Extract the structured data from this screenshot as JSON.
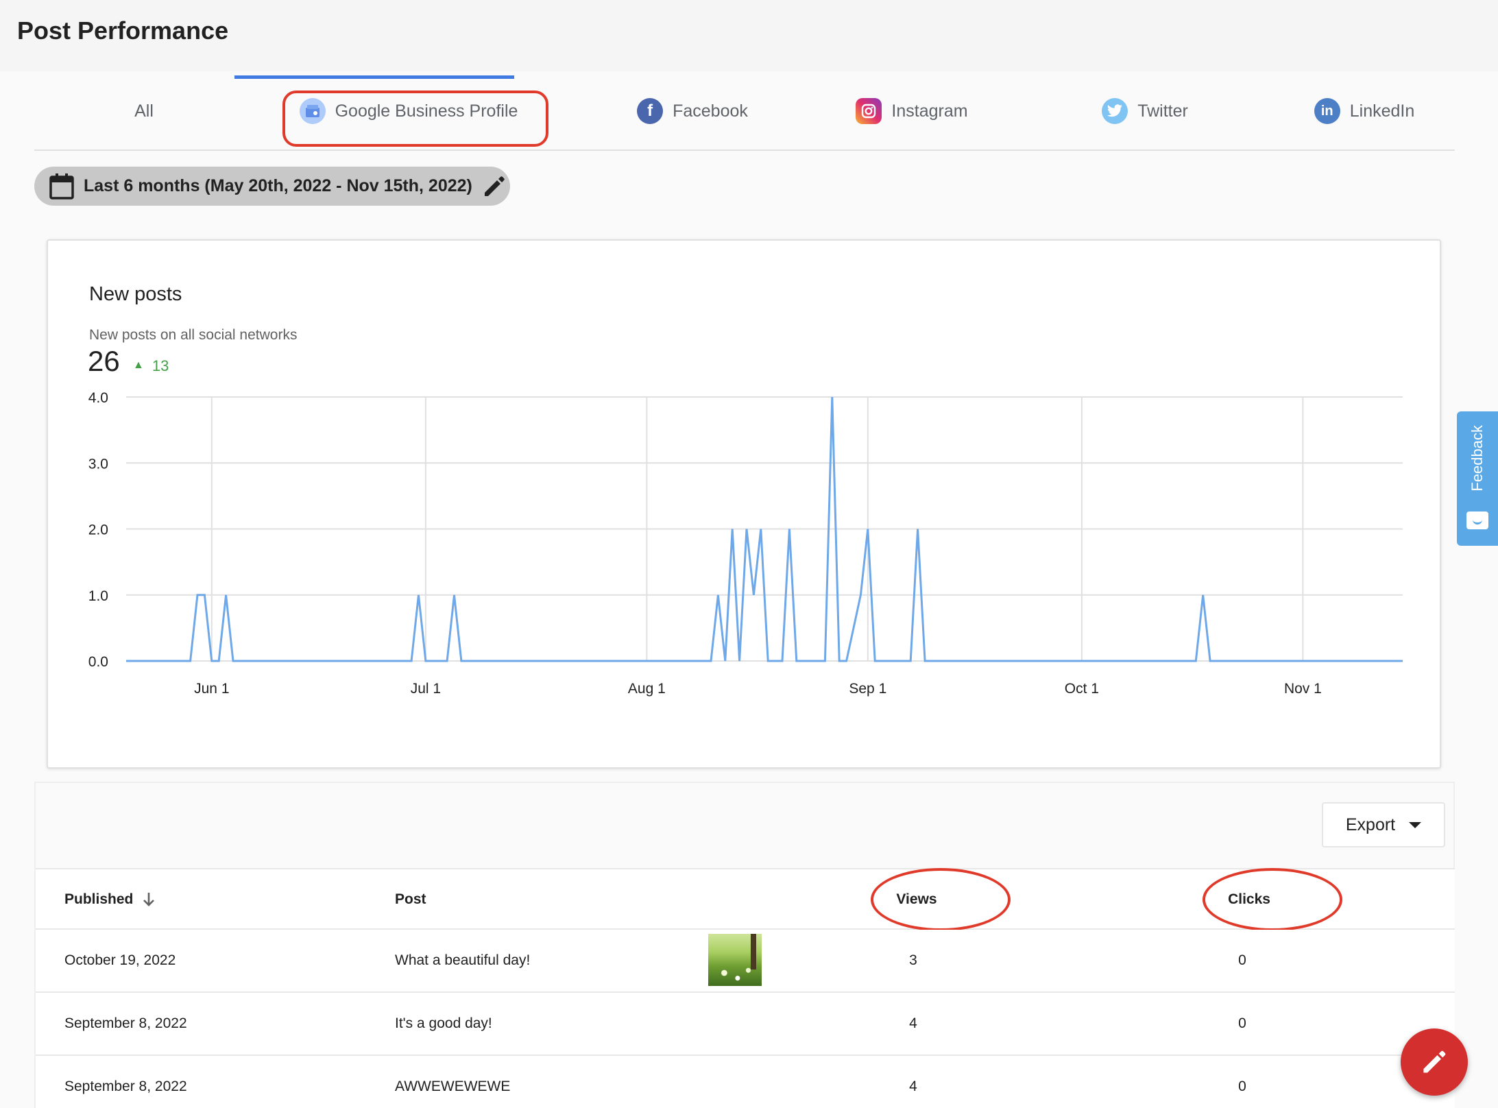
{
  "header": {
    "title": "Post Performance"
  },
  "tabs": [
    {
      "label": "All",
      "icon": ""
    },
    {
      "label": "Google Business Profile",
      "icon": "google-business-icon",
      "color": "#8ab4f8"
    },
    {
      "label": "Facebook",
      "icon": "facebook-icon",
      "color": "#4a67ad"
    },
    {
      "label": "Instagram",
      "icon": "instagram-icon",
      "color": "#d6249f"
    },
    {
      "label": "Twitter",
      "icon": "twitter-icon",
      "color": "#1da1f2"
    },
    {
      "label": "LinkedIn",
      "icon": "linkedin-icon",
      "color": "#0a66c2"
    }
  ],
  "active_tab": "Google Business Profile",
  "date_range": {
    "label": "Last 6 months (May 20th, 2022 - Nov 15th, 2022)"
  },
  "chart_card": {
    "title": "New posts",
    "subtitle": "New posts on all social networks",
    "total": "26",
    "delta": "13"
  },
  "chart_data": {
    "type": "line",
    "title": "New posts",
    "xlabel": "",
    "ylabel": "",
    "color": "#6fa8e8",
    "x_start": "2022-05-20",
    "x_end": "2022-11-15",
    "xlim": [
      "2022-05-20",
      "2022-11-15"
    ],
    "ylim": [
      0,
      4
    ],
    "y_ticks": [
      "0.0",
      "1.0",
      "2.0",
      "3.0",
      "4.0"
    ],
    "x_ticks": [
      {
        "label": "Jun 1",
        "date": "2022-06-01"
      },
      {
        "label": "Jul 1",
        "date": "2022-07-01"
      },
      {
        "label": "Aug 1",
        "date": "2022-08-01"
      },
      {
        "label": "Sep 1",
        "date": "2022-09-01"
      },
      {
        "label": "Oct 1",
        "date": "2022-10-01"
      },
      {
        "label": "Nov 1",
        "date": "2022-11-01"
      }
    ],
    "grid": true,
    "series": [
      {
        "values": [
          [
            "2022-05-20",
            0
          ],
          [
            "2022-05-29",
            0
          ],
          [
            "2022-05-30",
            1
          ],
          [
            "2022-05-31",
            1
          ],
          [
            "2022-06-01",
            0
          ],
          [
            "2022-06-02",
            0
          ],
          [
            "2022-06-03",
            1
          ],
          [
            "2022-06-04",
            0
          ],
          [
            "2022-06-29",
            0
          ],
          [
            "2022-06-30",
            1
          ],
          [
            "2022-07-01",
            0
          ],
          [
            "2022-07-04",
            0
          ],
          [
            "2022-07-05",
            1
          ],
          [
            "2022-07-06",
            0
          ],
          [
            "2022-08-10",
            0
          ],
          [
            "2022-08-11",
            1
          ],
          [
            "2022-08-12",
            0
          ],
          [
            "2022-08-13",
            2
          ],
          [
            "2022-08-14",
            0
          ],
          [
            "2022-08-15",
            2
          ],
          [
            "2022-08-16",
            1
          ],
          [
            "2022-08-17",
            2
          ],
          [
            "2022-08-18",
            0
          ],
          [
            "2022-08-20",
            0
          ],
          [
            "2022-08-21",
            2
          ],
          [
            "2022-08-22",
            0
          ],
          [
            "2022-08-26",
            0
          ],
          [
            "2022-08-27",
            4
          ],
          [
            "2022-08-28",
            0
          ],
          [
            "2022-08-29",
            0
          ],
          [
            "2022-08-31",
            1
          ],
          [
            "2022-09-01",
            2
          ],
          [
            "2022-09-02",
            0
          ],
          [
            "2022-09-07",
            0
          ],
          [
            "2022-09-08",
            2
          ],
          [
            "2022-09-09",
            0
          ],
          [
            "2022-10-17",
            0
          ],
          [
            "2022-10-18",
            1
          ],
          [
            "2022-10-19",
            0
          ],
          [
            "2022-11-15",
            0
          ]
        ]
      }
    ]
  },
  "table": {
    "export_label": "Export",
    "columns": [
      "Published",
      "Post",
      "Views",
      "Clicks"
    ],
    "rows": [
      {
        "published": "October 19, 2022",
        "post": "What a beautiful day!",
        "views": "3",
        "clicks": "0",
        "has_image": true
      },
      {
        "published": "September 8, 2022",
        "post": "It's a good day!",
        "views": "4",
        "clicks": "0",
        "has_image": false
      },
      {
        "published": "September 8, 2022",
        "post": "AWWEWEWEWE",
        "views": "4",
        "clicks": "0",
        "has_image": false
      }
    ]
  },
  "feedback": {
    "label": "Feedback"
  },
  "fab": {
    "icon": "pencil-icon"
  }
}
